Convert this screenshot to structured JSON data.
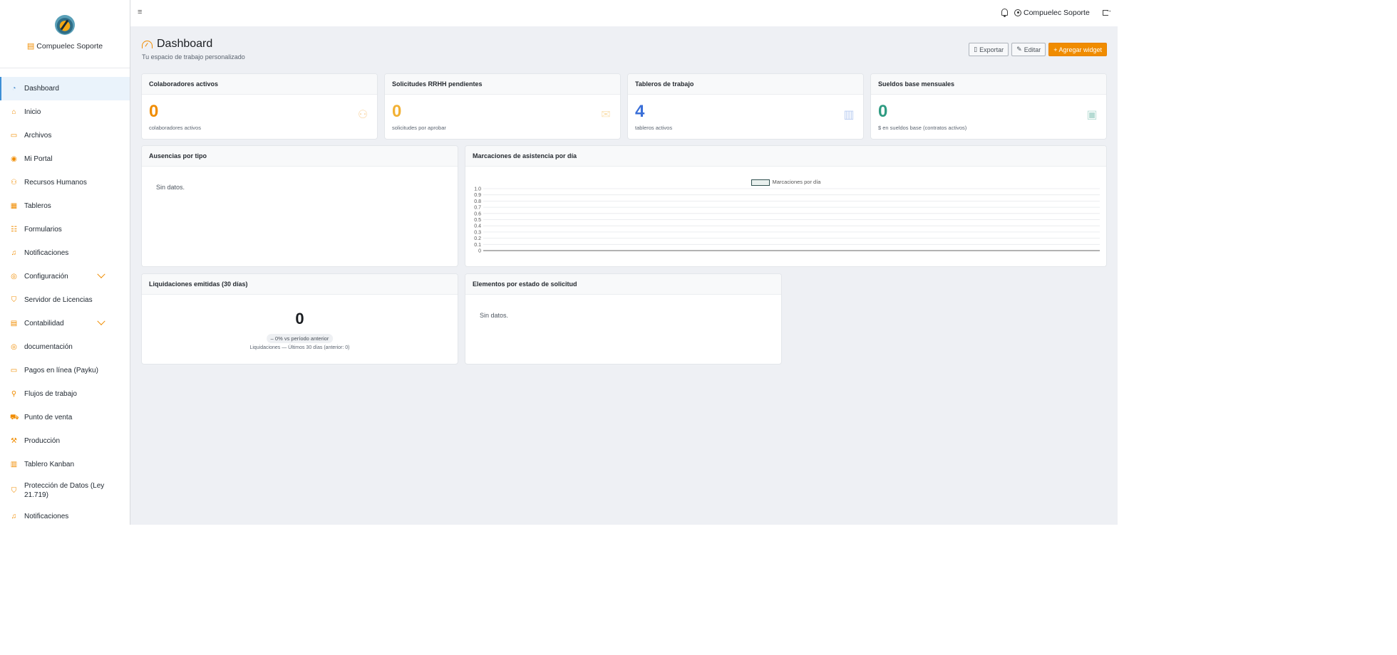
{
  "app": {
    "brand_name": "Compuelec Soporte"
  },
  "sidebar": {
    "items": [
      {
        "label": "Dashboard",
        "icon": "gauge-icon"
      },
      {
        "label": "Inicio",
        "icon": "home-icon"
      },
      {
        "label": "Archivos",
        "icon": "folder-icon"
      },
      {
        "label": "Mi Portal",
        "icon": "user-circle-icon"
      },
      {
        "label": "Recursos Humanos",
        "icon": "people-icon"
      },
      {
        "label": "Tableros",
        "icon": "grid-icon"
      },
      {
        "label": "Formularios",
        "icon": "form-icon"
      },
      {
        "label": "Notificaciones",
        "icon": "bell-icon"
      },
      {
        "label": "Configuración",
        "icon": "gear-icon"
      },
      {
        "label": "Servidor de Licencias",
        "icon": "shield-icon"
      },
      {
        "label": "Contabilidad",
        "icon": "calculator-icon"
      },
      {
        "label": "documentación",
        "icon": "gear-icon"
      },
      {
        "label": "Pagos en línea (Payku)",
        "icon": "card-icon"
      },
      {
        "label": "Flujos de trabajo",
        "icon": "flow-icon"
      },
      {
        "label": "Punto de venta",
        "icon": "cart-icon"
      },
      {
        "label": "Producción",
        "icon": "hammer-icon"
      },
      {
        "label": "Tablero Kanban",
        "icon": "kanban-icon"
      },
      {
        "label": "Protección de Datos (Ley 21.719)",
        "icon": "shield-icon"
      },
      {
        "label": "Notificaciones",
        "icon": "bell-icon"
      }
    ]
  },
  "topbar": {
    "menu_icon": "≡",
    "user_name": "Compuelec Soporte"
  },
  "page": {
    "title": "Dashboard",
    "subtitle": "Tu espacio de trabajo personalizado",
    "export_label": "Exportar",
    "edit_label": "Editar",
    "add_widget_label": "+ Agregar widget"
  },
  "stats": [
    {
      "title": "Colaboradores activos",
      "value": "0",
      "label": "colaboradores activos",
      "color": "#f08c00",
      "icon": "people-icon"
    },
    {
      "title": "Solicitudes RRHH pendientes",
      "value": "0",
      "label": "solicitudes por aprobar",
      "color": "#f2b134",
      "icon": "inbox-icon"
    },
    {
      "title": "Tableros de trabajo",
      "value": "4",
      "label": "tableros activos",
      "color": "#3a6fd8",
      "icon": "kanban-icon"
    },
    {
      "title": "Sueldos base mensuales",
      "value": "0",
      "label": "$ en sueldos base (contratos activos)",
      "color": "#2f9b82",
      "icon": "cash-icon"
    }
  ],
  "widgets": {
    "ausencias": {
      "title": "Ausencias por tipo",
      "empty": "Sin datos."
    },
    "marcaciones": {
      "title": "Marcaciones de asistencia por día"
    },
    "liquidaciones": {
      "title": "Liquidaciones emitidas (30 días)",
      "value": "0",
      "change": "– 0% vs período anterior",
      "footer": "Liquidaciones — Últimos 30 días (anterior: 0)"
    },
    "elementos": {
      "title": "Elementos por estado de solicitud",
      "empty": "Sin datos."
    }
  },
  "chart_data": {
    "type": "line",
    "title": "",
    "series": [
      {
        "name": "Marcaciones por día",
        "values": []
      }
    ],
    "x": [],
    "xlabel": "",
    "ylabel": "",
    "ylim": [
      0,
      1.0
    ],
    "yticks": [
      "0",
      "0.1",
      "0.2",
      "0.3",
      "0.4",
      "0.5",
      "0.6",
      "0.7",
      "0.8",
      "0.9",
      "1.0"
    ],
    "grid": true,
    "legend": "top-center"
  }
}
